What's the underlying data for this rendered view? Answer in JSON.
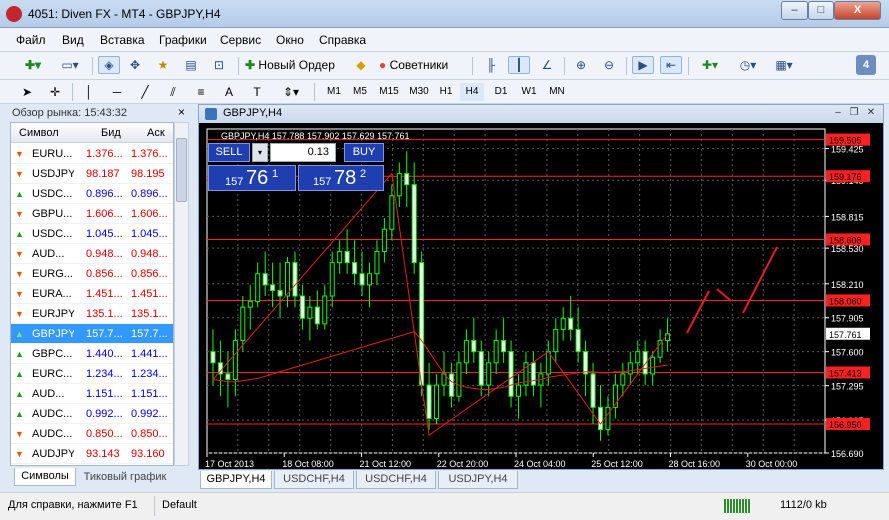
{
  "window": {
    "title": "4051: Diven FX - MT4 - GBPJPY,H4",
    "min": "–",
    "max": "□",
    "close": "X"
  },
  "menu": [
    "Файл",
    "Вид",
    "Вставка",
    "Графики",
    "Сервис",
    "Окно",
    "Справка"
  ],
  "toolbar": {
    "new_order": "Новый Ордер",
    "advisors": "Советники",
    "expert_badge": "4"
  },
  "timeframes": [
    "M1",
    "M5",
    "M15",
    "M30",
    "H1",
    "H4",
    "D1",
    "W1",
    "MN"
  ],
  "active_timeframe": "H4",
  "market_watch": {
    "header": "Обзор рынка: 15:43:32",
    "cols": {
      "symbol": "Символ",
      "bid": "Бид",
      "ask": "Аск"
    },
    "rows": [
      {
        "sym": "EURU...",
        "bid": "1.376...",
        "ask": "1.376...",
        "dir": "down",
        "color": "#d40000"
      },
      {
        "sym": "USDJPY",
        "bid": "98.187",
        "ask": "98.195",
        "dir": "down",
        "color": "#d40000"
      },
      {
        "sym": "USDC...",
        "bid": "0.896...",
        "ask": "0.896...",
        "dir": "up",
        "color": "#0000d4"
      },
      {
        "sym": "GBPU...",
        "bid": "1.606...",
        "ask": "1.606...",
        "dir": "down",
        "color": "#d40000"
      },
      {
        "sym": "USDC...",
        "bid": "1.045...",
        "ask": "1.045...",
        "dir": "up",
        "color": "#0000d4"
      },
      {
        "sym": "AUD...",
        "bid": "0.948...",
        "ask": "0.948...",
        "dir": "down",
        "color": "#d40000"
      },
      {
        "sym": "EURG...",
        "bid": "0.856...",
        "ask": "0.856...",
        "dir": "down",
        "color": "#d40000"
      },
      {
        "sym": "EURA...",
        "bid": "1.451...",
        "ask": "1.451...",
        "dir": "down",
        "color": "#d40000"
      },
      {
        "sym": "EURJPY",
        "bid": "135.1...",
        "ask": "135.1...",
        "dir": "down",
        "color": "#d40000"
      },
      {
        "sym": "GBPJPY",
        "bid": "157.7...",
        "ask": "157.7...",
        "dir": "up",
        "color": "#ffffff",
        "selected": true
      },
      {
        "sym": "GBPC...",
        "bid": "1.440...",
        "ask": "1.441...",
        "dir": "up",
        "color": "#0000d4"
      },
      {
        "sym": "EURC...",
        "bid": "1.234...",
        "ask": "1.234...",
        "dir": "up",
        "color": "#0000d4"
      },
      {
        "sym": "AUD...",
        "bid": "1.151...",
        "ask": "1.151...",
        "dir": "up",
        "color": "#0000d4"
      },
      {
        "sym": "AUDC...",
        "bid": "0.992...",
        "ask": "0.992...",
        "dir": "up",
        "color": "#0000d4"
      },
      {
        "sym": "AUDC...",
        "bid": "0.850...",
        "ask": "0.850...",
        "dir": "down",
        "color": "#d40000"
      },
      {
        "sym": "AUDJPY",
        "bid": "93.143",
        "ask": "93.160",
        "dir": "down",
        "color": "#d40000"
      }
    ],
    "tabs": [
      "Символы",
      "Тиковый график"
    ]
  },
  "chart": {
    "window_title": "GBPJPY,H4",
    "info_line": "GBPJPY,H4  157.788 157.902 157.629 157.761",
    "one_click": {
      "sell": "SELL",
      "buy": "BUY",
      "lot": "0.13",
      "sell_price_small": "157",
      "sell_price_big": "76",
      "sell_price_sup": "1",
      "buy_price_small": "157",
      "buy_price_big": "78",
      "buy_price_sup": "2"
    },
    "current_price": "157.761"
  },
  "chart_data": {
    "type": "candlestick",
    "title": "GBPJPY,H4",
    "ylim": [
      156.69,
      159.6
    ],
    "y_ticks": [
      "159.425",
      "159.140",
      "158.815",
      "158.530",
      "158.210",
      "157.905",
      "157.600",
      "157.295",
      "156.985",
      "156.690"
    ],
    "x_ticks": [
      "17 Oct 2013",
      "18 Oct 08:00",
      "21 Oct 12:00",
      "22 Oct 20:00",
      "24 Oct 04:00",
      "25 Oct 12:00",
      "28 Oct 16:00",
      "30 Oct 00:00"
    ],
    "hlines": [
      "159.505",
      "159.176",
      "158.608",
      "158.060",
      "157.413",
      "156.950"
    ],
    "line_color": "#ff2020",
    "candles": [
      [
        157.6,
        157.8,
        157.3,
        157.5
      ],
      [
        157.5,
        157.7,
        157.2,
        157.4
      ],
      [
        157.4,
        157.6,
        157.1,
        157.35
      ],
      [
        157.35,
        157.8,
        157.2,
        157.7
      ],
      [
        157.7,
        158.1,
        157.6,
        158.0
      ],
      [
        158.0,
        158.2,
        157.8,
        158.05
      ],
      [
        158.05,
        158.4,
        158.0,
        158.3
      ],
      [
        158.3,
        158.5,
        158.1,
        158.2
      ],
      [
        158.2,
        158.4,
        158.0,
        158.15
      ],
      [
        158.15,
        158.4,
        157.9,
        158.1
      ],
      [
        158.1,
        158.45,
        158.0,
        158.4
      ],
      [
        158.4,
        158.5,
        158.0,
        158.1
      ],
      [
        158.1,
        158.2,
        157.8,
        157.9
      ],
      [
        157.9,
        158.1,
        157.7,
        158.0
      ],
      [
        158.0,
        158.15,
        157.8,
        157.85
      ],
      [
        157.85,
        158.2,
        157.8,
        158.1
      ],
      [
        158.1,
        158.5,
        158.0,
        158.4
      ],
      [
        158.4,
        158.6,
        158.3,
        158.5
      ],
      [
        158.5,
        158.7,
        158.3,
        158.4
      ],
      [
        158.4,
        158.6,
        158.2,
        158.3
      ],
      [
        158.3,
        158.5,
        158.1,
        158.2
      ],
      [
        158.2,
        158.4,
        158.0,
        158.3
      ],
      [
        158.3,
        158.6,
        158.2,
        158.5
      ],
      [
        158.5,
        158.8,
        158.4,
        158.7
      ],
      [
        158.7,
        159.1,
        158.6,
        159.0
      ],
      [
        159.0,
        159.3,
        158.9,
        159.2
      ],
      [
        159.2,
        159.4,
        158.9,
        159.1
      ],
      [
        159.1,
        159.3,
        158.3,
        158.4
      ],
      [
        158.4,
        158.5,
        157.2,
        157.3
      ],
      [
        157.3,
        157.5,
        156.9,
        157.0
      ],
      [
        157.0,
        157.4,
        156.95,
        157.3
      ],
      [
        157.3,
        157.6,
        157.2,
        157.4
      ],
      [
        157.4,
        157.5,
        157.1,
        157.2
      ],
      [
        157.2,
        157.6,
        157.15,
        157.5
      ],
      [
        157.5,
        157.8,
        157.4,
        157.7
      ],
      [
        157.7,
        157.9,
        157.5,
        157.6
      ],
      [
        157.6,
        157.7,
        157.2,
        157.3
      ],
      [
        157.3,
        157.6,
        157.2,
        157.5
      ],
      [
        157.5,
        157.8,
        157.4,
        157.7
      ],
      [
        157.7,
        157.9,
        157.5,
        157.6
      ],
      [
        157.6,
        157.7,
        157.1,
        157.2
      ],
      [
        157.2,
        157.4,
        157.0,
        157.3
      ],
      [
        157.3,
        157.6,
        157.2,
        157.5
      ],
      [
        157.5,
        157.6,
        157.2,
        157.3
      ],
      [
        157.3,
        157.5,
        157.1,
        157.4
      ],
      [
        157.4,
        157.7,
        157.3,
        157.6
      ],
      [
        157.6,
        157.9,
        157.5,
        157.8
      ],
      [
        157.8,
        158.0,
        157.7,
        157.9
      ],
      [
        157.9,
        158.1,
        157.7,
        157.8
      ],
      [
        157.8,
        158.0,
        157.5,
        157.6
      ],
      [
        157.6,
        157.7,
        157.2,
        157.4
      ],
      [
        157.4,
        157.5,
        156.95,
        157.1
      ],
      [
        157.1,
        157.3,
        156.8,
        156.9
      ],
      [
        156.9,
        157.2,
        156.85,
        157.1
      ],
      [
        157.1,
        157.4,
        157.0,
        157.3
      ],
      [
        157.3,
        157.5,
        157.2,
        157.4
      ],
      [
        157.4,
        157.6,
        157.3,
        157.5
      ],
      [
        157.5,
        157.7,
        157.4,
        157.6
      ],
      [
        157.6,
        157.7,
        157.3,
        157.4
      ],
      [
        157.4,
        157.6,
        157.3,
        157.55
      ],
      [
        157.55,
        157.8,
        157.5,
        157.7
      ],
      [
        157.7,
        157.9,
        157.6,
        157.76
      ]
    ],
    "ma": [
      157.35,
      157.34,
      157.33,
      157.33,
      157.34,
      157.35,
      157.36,
      157.38,
      157.4,
      157.42,
      157.44,
      157.46,
      157.48,
      157.5,
      157.52,
      157.54,
      157.56,
      157.58,
      157.6,
      157.62,
      157.64,
      157.66,
      157.68,
      157.7,
      157.72,
      157.74,
      157.76,
      157.78,
      157.7,
      157.6,
      157.5,
      157.4,
      157.33,
      157.3,
      157.28,
      157.27,
      157.26,
      157.26,
      157.27,
      157.28,
      157.3,
      157.32,
      157.33,
      157.34,
      157.35,
      157.37,
      157.38,
      157.39,
      157.4,
      157.41,
      157.42,
      157.42,
      157.41,
      157.41,
      157.42,
      157.42,
      157.43,
      157.44,
      157.45,
      157.46,
      157.47,
      157.48
    ]
  },
  "tabs": [
    "GBPJPY,H4",
    "USDCHF,H4",
    "USDCHF,H4",
    "USDJPY,H4"
  ],
  "status": {
    "help": "Для справки, нажмите F1",
    "profile": "Default",
    "traffic": "1112/0 kb"
  }
}
